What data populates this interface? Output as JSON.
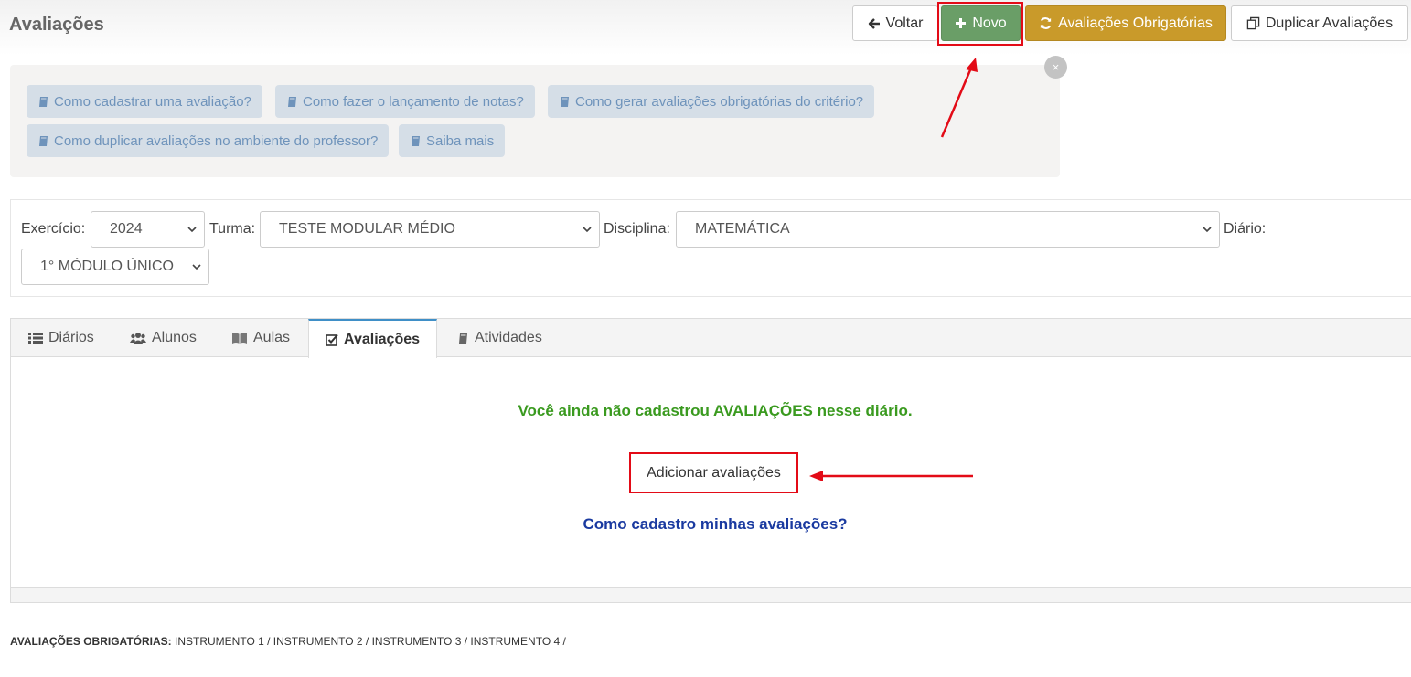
{
  "page": {
    "title": "Avaliações"
  },
  "toolbar": {
    "back_label": "Voltar",
    "new_label": "Novo",
    "mandatory_label": "Avaliações Obrigatórias",
    "duplicate_label": "Duplicar Avaliações"
  },
  "help": {
    "close_symbol": "×",
    "links": [
      {
        "label": "Como cadastrar uma avaliação?"
      },
      {
        "label": "Como fazer o lançamento de notas?"
      },
      {
        "label": "Como gerar avaliações obrigatórias do critério?"
      },
      {
        "label": "Como duplicar avaliações no ambiente do professor?"
      },
      {
        "label": "Saiba mais"
      }
    ]
  },
  "filters": {
    "exercicio_label": "Exercício:",
    "exercicio_value": "2024",
    "turma_label": "Turma:",
    "turma_value": "TESTE MODULAR MÉDIO",
    "disciplina_label": "Disciplina:",
    "disciplina_value": "MATEMÁTICA",
    "diario_label": "Diário:",
    "diario_value": "1° MÓDULO ÚNICO"
  },
  "tabs": [
    {
      "label": "Diários",
      "icon": "list-icon"
    },
    {
      "label": "Alunos",
      "icon": "users-icon"
    },
    {
      "label": "Aulas",
      "icon": "book-open-icon"
    },
    {
      "label": "Avaliações",
      "icon": "check-square-icon",
      "active": true
    },
    {
      "label": "Atividades",
      "icon": "book-icon"
    }
  ],
  "content": {
    "empty_prefix": "Você ainda não cadastrou ",
    "empty_highlight": "AVALIAÇÕES",
    "empty_suffix": " nesse diário.",
    "add_button": "Adicionar avaliações",
    "how_link": "Como cadastro minhas avaliações?"
  },
  "footer": {
    "label": "AVALIAÇÕES OBRIGATÓRIAS:",
    "items": "INSTRUMENTO 1 / INSTRUMENTO 2 / INSTRUMENTO 3 / INSTRUMENTO 4 /"
  },
  "colors": {
    "novo_button": "#6a9e67",
    "obrigatorias_button": "#c99a2a",
    "annotation_red": "#e30b17",
    "empty_message_green": "#3a9a1f",
    "link_blue": "#1a3aa0",
    "active_tab_accent": "#3f8fc7"
  }
}
